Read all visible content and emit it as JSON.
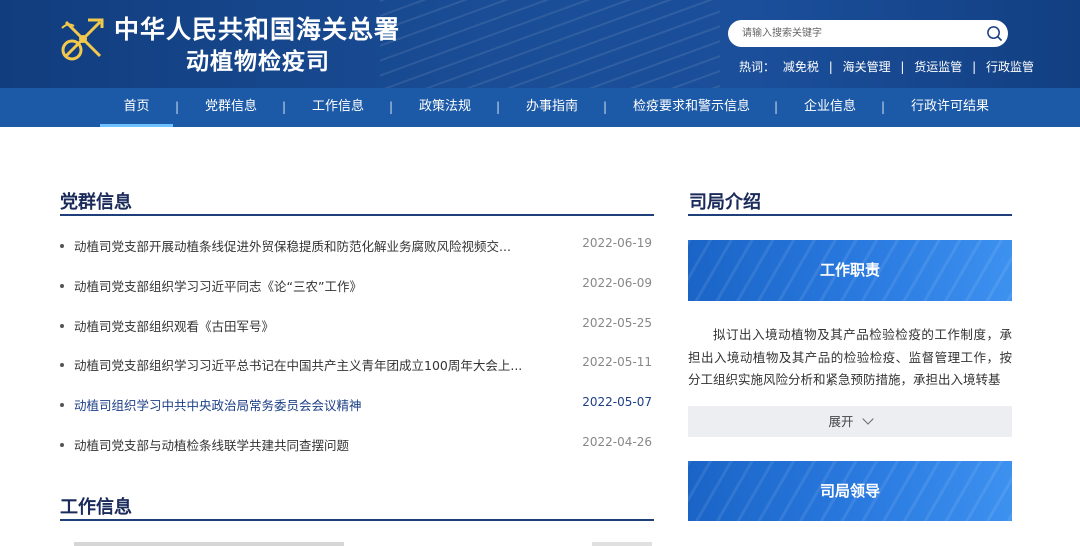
{
  "header": {
    "title": "中华人民共和国海关总署",
    "subtitle": "动植物检疫司",
    "search": {
      "placeholder": "请输入搜索关键字"
    },
    "hot_label": "热词：",
    "hot_words": [
      "减免税",
      "海关管理",
      "货运监管",
      "行政监管"
    ]
  },
  "nav": {
    "items": [
      "首页",
      "党群信息",
      "工作信息",
      "政策法规",
      "办事指南",
      "检疫要求和警示信息",
      "企业信息",
      "行政许可结果"
    ],
    "active_index": 0
  },
  "party_section": {
    "title": "党群信息",
    "items": [
      {
        "title": "动植司党支部开展动植条线促进外贸保稳提质和防范化解业务腐败风险视频交...",
        "date": "2022-06-19"
      },
      {
        "title": "动植司党支部组织学习习近平同志《论“三农”工作》",
        "date": "2022-06-09"
      },
      {
        "title": "动植司党支部组织观看《古田军号》",
        "date": "2022-05-25"
      },
      {
        "title": "动植司党支部组织学习习近平总书记在中国共产主义青年团成立100周年大会上...",
        "date": "2022-05-11"
      },
      {
        "title": "动植司组织学习中共中央政治局常务委员会会议精神",
        "date": "2022-05-07"
      },
      {
        "title": "动植司党支部与动植检条线联学共建共同查摆问题",
        "date": "2022-04-26"
      }
    ]
  },
  "work_section": {
    "title": "工作信息"
  },
  "dept_section": {
    "title": "司局介绍",
    "duties_banner": "工作职责",
    "duties_text": "拟订出入境动植物及其产品检验检疫的工作制度，承担出入境动植物及其产品的检验检疫、监督管理工作，按分工组织实施风险分析和紧急预防措施，承担出入境转基",
    "expand_label": "展开",
    "leaders_banner": "司局领导"
  },
  "colors": {
    "header_bg": "#1a4d96",
    "nav_bg": "#1c5aa8",
    "accent_underline": "#6ec1ff",
    "section_rule": "#1f3f7a",
    "banner_blue": "#2a7ae0"
  }
}
